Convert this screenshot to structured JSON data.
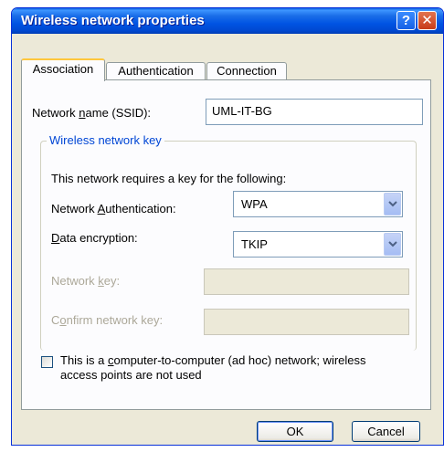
{
  "window": {
    "title": "Wireless network properties",
    "help_glyph": "?",
    "close_glyph": "✕"
  },
  "tabs": [
    {
      "label": "Association",
      "active": true
    },
    {
      "label": "Authentication",
      "active": false
    },
    {
      "label": "Connection",
      "active": false
    }
  ],
  "association": {
    "ssid_label_pre": "Network ",
    "ssid_label_key": "n",
    "ssid_label_post": "ame (SSID):",
    "ssid_value": "UML-IT-BG",
    "key_group_title": "Wireless network key",
    "key_description": "This network requires a key for the following:",
    "auth_label_pre": "Network ",
    "auth_label_key": "A",
    "auth_label_post": "uthentication:",
    "auth_value": "WPA",
    "enc_label_key": "D",
    "enc_label_post": "ata encryption:",
    "enc_value": "TKIP",
    "netkey_label_pre": "Network ",
    "netkey_label_key": "k",
    "netkey_label_post": "ey:",
    "netkey_value": "",
    "confirm_label_pre": "C",
    "confirm_label_key": "o",
    "confirm_label_post": "nfirm network key:",
    "confirm_value": "",
    "adhoc_checked": false,
    "adhoc_line1_pre": "This is a ",
    "adhoc_line1_key": "c",
    "adhoc_line1_post": "omputer-to-computer (ad hoc) network; wireless",
    "adhoc_line2": "access points are not used"
  },
  "buttons": {
    "ok": "OK",
    "cancel": "Cancel"
  }
}
